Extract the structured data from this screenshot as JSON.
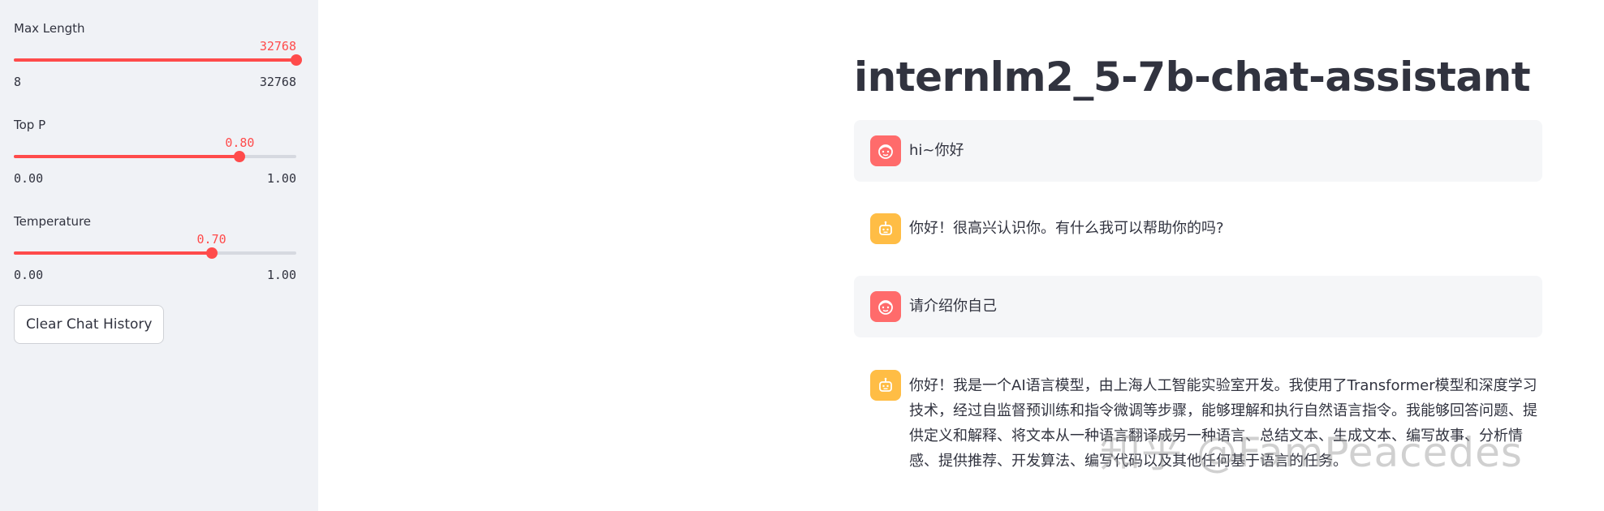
{
  "sidebar": {
    "sliders": [
      {
        "label": "Max Length",
        "value": "32768",
        "min": "8",
        "max": "32768",
        "fraction": 1.0
      },
      {
        "label": "Top P",
        "value": "0.80",
        "min": "0.00",
        "max": "1.00",
        "fraction": 0.8
      },
      {
        "label": "Temperature",
        "value": "0.70",
        "min": "0.00",
        "max": "1.00",
        "fraction": 0.7
      }
    ],
    "clear_button_label": "Clear Chat History"
  },
  "main": {
    "title": "internlm2_5-7b-chat-assistant",
    "messages": [
      {
        "role": "user",
        "text": "hi~你好"
      },
      {
        "role": "assistant",
        "text": "你好！很高兴认识你。有什么我可以帮助你的吗?"
      },
      {
        "role": "user",
        "text": "请介绍你自己"
      },
      {
        "role": "assistant",
        "text": "你好！我是一个AI语言模型，由上海人工智能实验室开发。我使用了Transformer模型和深度学习技术，经过自监督预训练和指令微调等步骤，能够理解和执行自然语言指令。我能够回答问题、提供定义和解释、将文本从一种语言翻译成另一种语言、总结文本、生成文本、编写故事、分析情感、提供推荐、开发算法、编写代码以及其他任何基于语言的任务。"
      }
    ]
  },
  "watermark": "知乎 @FamPeacedes",
  "colors": {
    "accent": "#ff4b4b",
    "sidebar_bg": "#f0f2f6",
    "user_avatar": "#ff6b6b",
    "assistant_avatar": "#ffbd45",
    "text": "#31333f"
  },
  "icons": {
    "user_avatar": "face-icon",
    "assistant_avatar": "robot-icon"
  }
}
